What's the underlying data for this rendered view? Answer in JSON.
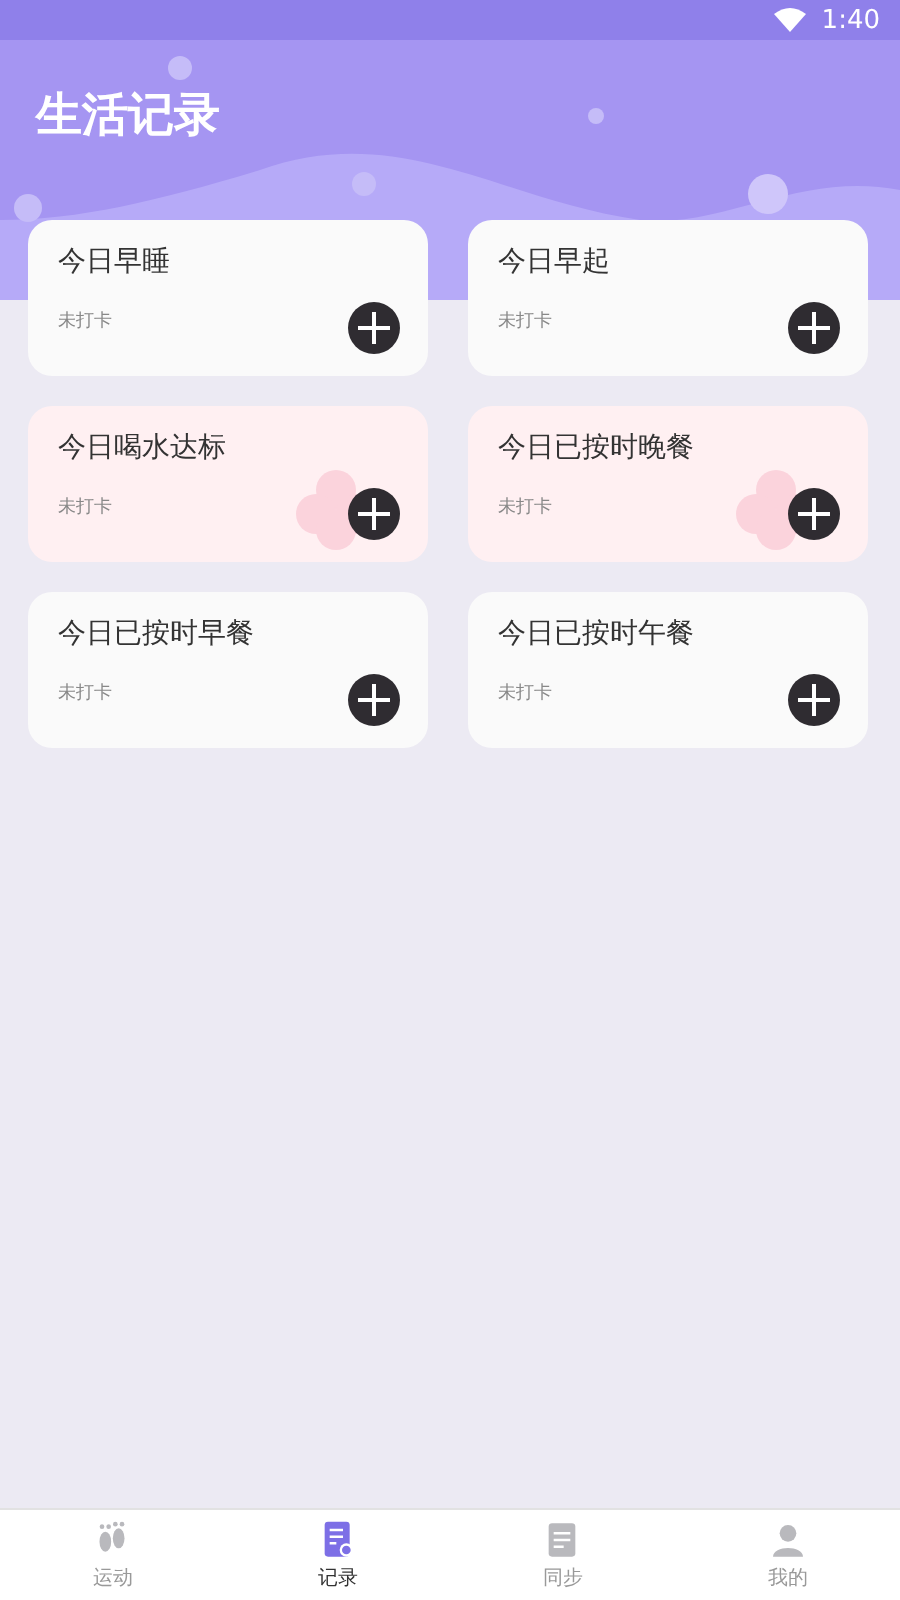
{
  "status_bar": {
    "time": "1:40"
  },
  "header": {
    "title": "生活记录"
  },
  "cards": [
    {
      "title": "今日早睡",
      "status": "未打卡",
      "kind": "plain"
    },
    {
      "title": "今日早起",
      "status": "未打卡",
      "kind": "plain"
    },
    {
      "title": "今日喝水达标",
      "status": "未打卡",
      "kind": "flower"
    },
    {
      "title": "今日已按时晚餐",
      "status": "未打卡",
      "kind": "flower"
    },
    {
      "title": "今日已按时早餐",
      "status": "未打卡",
      "kind": "plain"
    },
    {
      "title": "今日已按时午餐",
      "status": "未打卡",
      "kind": "plain"
    }
  ],
  "bottom_nav": [
    {
      "label": "运动",
      "kind": "feet",
      "selected": false
    },
    {
      "label": "记录",
      "kind": "record",
      "selected": true
    },
    {
      "label": "同步",
      "kind": "doc",
      "selected": false
    },
    {
      "label": "我的",
      "kind": "person",
      "selected": false
    }
  ]
}
